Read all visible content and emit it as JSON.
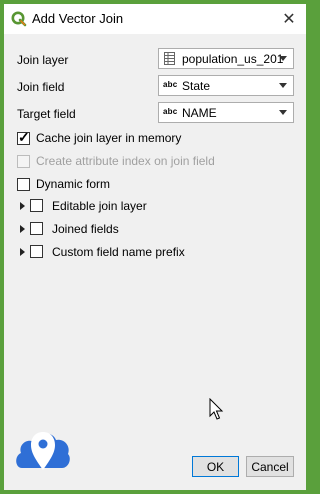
{
  "window": {
    "title": "Add Vector Join"
  },
  "fields": [
    {
      "label": "Join layer",
      "value": "population_us_201",
      "icon": "vector-table-icon"
    },
    {
      "label": "Join field",
      "value": "State",
      "icon": "abc-text-field-icon",
      "icon_text": "abc"
    },
    {
      "label": "Target field",
      "value": "NAME",
      "icon": "abc-text-field-icon",
      "icon_text": "abc"
    }
  ],
  "options": [
    {
      "label": "Cache join layer in memory",
      "checked": true,
      "enabled": true
    },
    {
      "label": "Create attribute index on join field",
      "checked": false,
      "enabled": false
    },
    {
      "label": "Dynamic form",
      "checked": false,
      "enabled": true
    }
  ],
  "groups": [
    {
      "label": "Editable join layer",
      "checked": false
    },
    {
      "label": "Joined fields",
      "checked": false
    },
    {
      "label": "Custom field name prefix",
      "checked": false
    }
  ],
  "buttons": {
    "ok": "OK",
    "cancel": "Cancel"
  },
  "colors": {
    "accent": "#0078d7",
    "frame": "#5aa03c",
    "logo": "#2f6fd6"
  }
}
